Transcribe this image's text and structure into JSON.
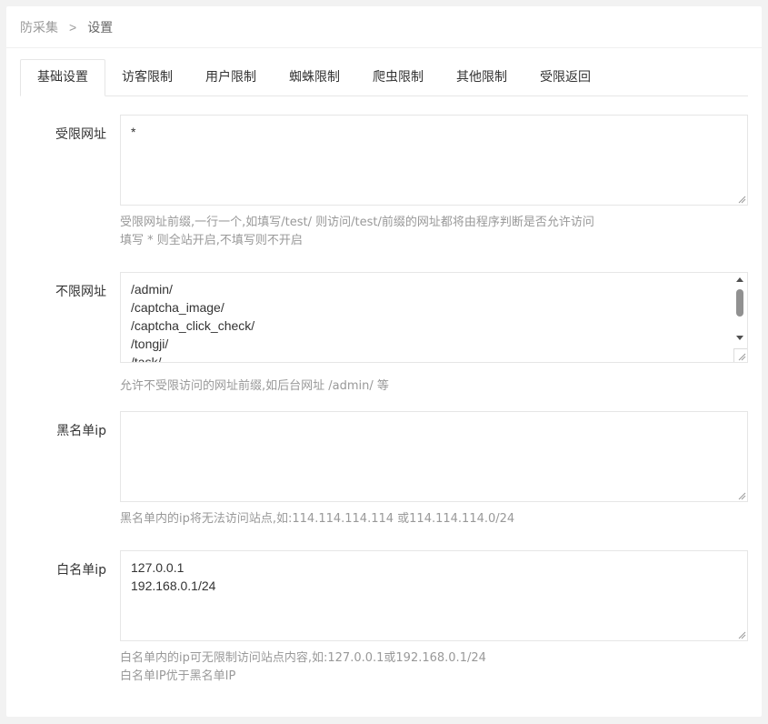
{
  "breadcrumb": {
    "root": "防采集",
    "separator": ">",
    "current": "设置"
  },
  "tabs": [
    {
      "label": "基础设置",
      "active": true
    },
    {
      "label": "访客限制",
      "active": false
    },
    {
      "label": "用户限制",
      "active": false
    },
    {
      "label": "蜘蛛限制",
      "active": false
    },
    {
      "label": "爬虫限制",
      "active": false
    },
    {
      "label": "其他限制",
      "active": false
    },
    {
      "label": "受限返回",
      "active": false
    }
  ],
  "fields": {
    "restricted_url": {
      "label": "受限网址",
      "value": "*",
      "hint_line1": "受限网址前缀,一行一个,如填写/test/ 则访问/test/前缀的网址都将由程序判断是否允许访问",
      "hint_line2": "填写 * 则全站开启,不填写则不开启"
    },
    "unrestricted_url": {
      "label": "不限网址",
      "value": "/admin/\n/captcha_image/\n/captcha_click_check/\n/tongji/\n/task/",
      "hint_line1": "允许不受限访问的网址前缀,如后台网址 /admin/ 等"
    },
    "blacklist_ip": {
      "label": "黑名单ip",
      "value": "",
      "hint_line1": "黑名单内的ip将无法访问站点,如:114.114.114.114 或114.114.114.0/24"
    },
    "whitelist_ip": {
      "label": "白名单ip",
      "value": "127.0.0.1\n192.168.0.1/24",
      "hint_line1": "白名单内的ip可无限制访问站点内容,如:127.0.0.1或192.168.0.1/24",
      "hint_line2": "白名单IP优于黑名单IP"
    }
  },
  "icons": {
    "resize": "resize-grip-icon",
    "scroll_up": "arrow-up-icon",
    "scroll_down": "arrow-down-icon"
  }
}
